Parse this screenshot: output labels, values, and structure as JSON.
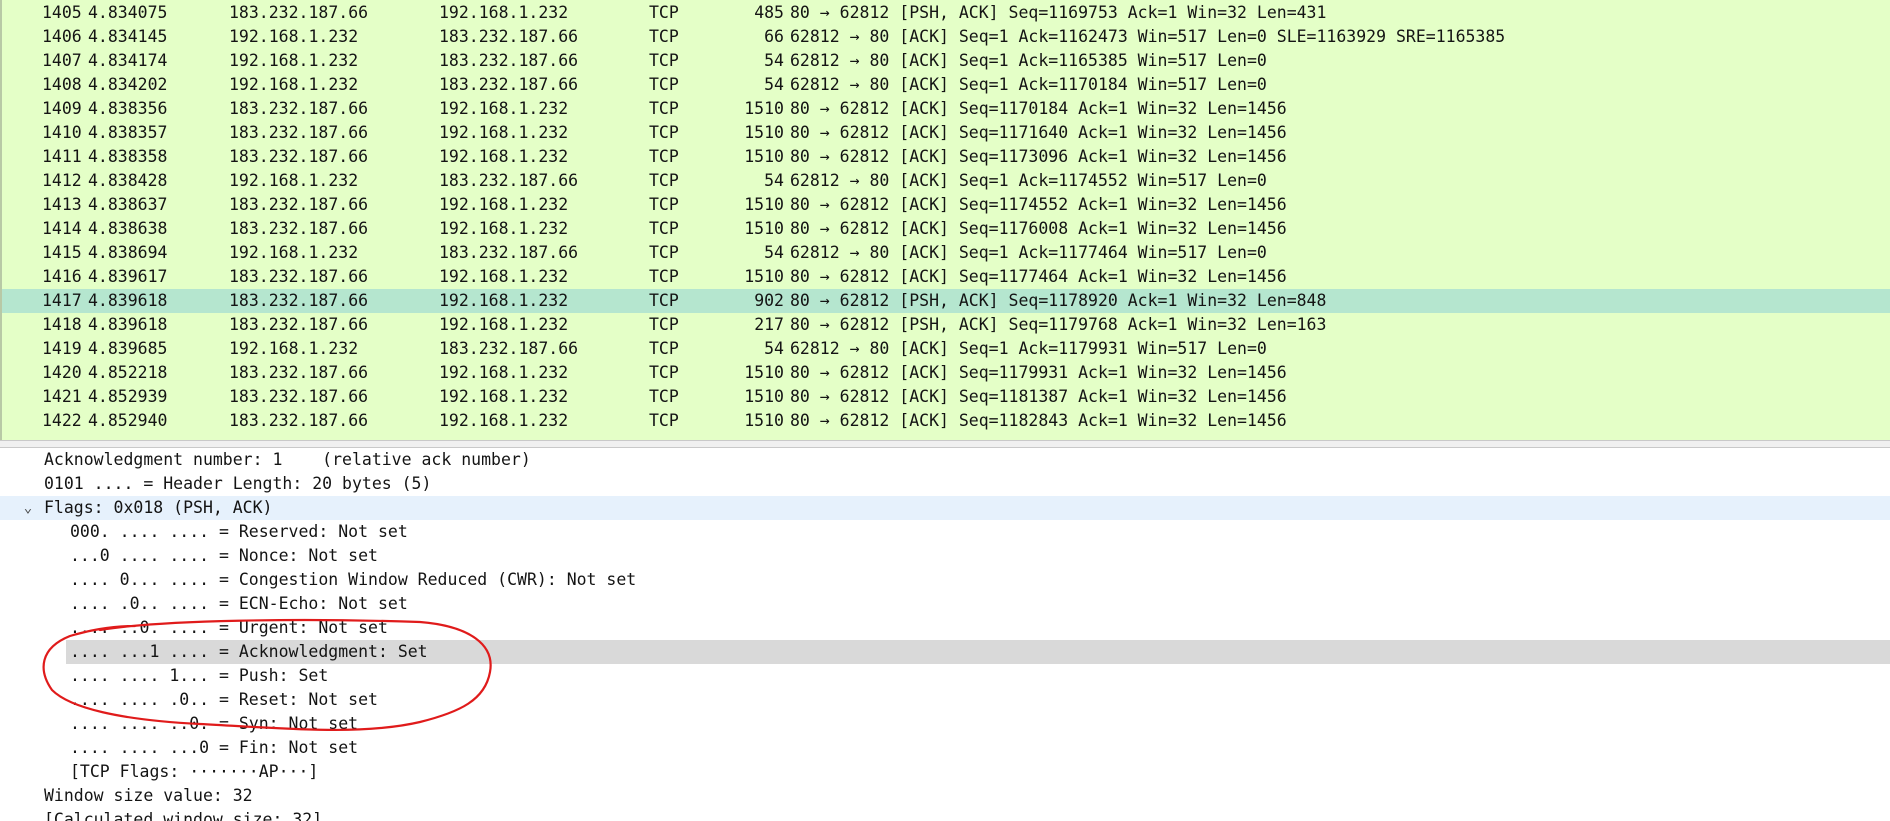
{
  "packet_list": {
    "rows": [
      {
        "no": "1405",
        "time": "4.834075",
        "src": "183.232.187.66",
        "dst": "192.168.1.232",
        "proto": "TCP",
        "len": "485",
        "info": "80 → 62812 [PSH, ACK] Seq=1169753 Ack=1 Win=32 Len=431",
        "selected": false
      },
      {
        "no": "1406",
        "time": "4.834145",
        "src": "192.168.1.232",
        "dst": "183.232.187.66",
        "proto": "TCP",
        "len": "66",
        "info": "62812 → 80 [ACK] Seq=1 Ack=1162473 Win=517 Len=0 SLE=1163929 SRE=1165385",
        "selected": false
      },
      {
        "no": "1407",
        "time": "4.834174",
        "src": "192.168.1.232",
        "dst": "183.232.187.66",
        "proto": "TCP",
        "len": "54",
        "info": "62812 → 80 [ACK] Seq=1 Ack=1165385 Win=517 Len=0",
        "selected": false
      },
      {
        "no": "1408",
        "time": "4.834202",
        "src": "192.168.1.232",
        "dst": "183.232.187.66",
        "proto": "TCP",
        "len": "54",
        "info": "62812 → 80 [ACK] Seq=1 Ack=1170184 Win=517 Len=0",
        "selected": false
      },
      {
        "no": "1409",
        "time": "4.838356",
        "src": "183.232.187.66",
        "dst": "192.168.1.232",
        "proto": "TCP",
        "len": "1510",
        "info": "80 → 62812 [ACK] Seq=1170184 Ack=1 Win=32 Len=1456",
        "selected": false
      },
      {
        "no": "1410",
        "time": "4.838357",
        "src": "183.232.187.66",
        "dst": "192.168.1.232",
        "proto": "TCP",
        "len": "1510",
        "info": "80 → 62812 [ACK] Seq=1171640 Ack=1 Win=32 Len=1456",
        "selected": false
      },
      {
        "no": "1411",
        "time": "4.838358",
        "src": "183.232.187.66",
        "dst": "192.168.1.232",
        "proto": "TCP",
        "len": "1510",
        "info": "80 → 62812 [ACK] Seq=1173096 Ack=1 Win=32 Len=1456",
        "selected": false
      },
      {
        "no": "1412",
        "time": "4.838428",
        "src": "192.168.1.232",
        "dst": "183.232.187.66",
        "proto": "TCP",
        "len": "54",
        "info": "62812 → 80 [ACK] Seq=1 Ack=1174552 Win=517 Len=0",
        "selected": false
      },
      {
        "no": "1413",
        "time": "4.838637",
        "src": "183.232.187.66",
        "dst": "192.168.1.232",
        "proto": "TCP",
        "len": "1510",
        "info": "80 → 62812 [ACK] Seq=1174552 Ack=1 Win=32 Len=1456",
        "selected": false
      },
      {
        "no": "1414",
        "time": "4.838638",
        "src": "183.232.187.66",
        "dst": "192.168.1.232",
        "proto": "TCP",
        "len": "1510",
        "info": "80 → 62812 [ACK] Seq=1176008 Ack=1 Win=32 Len=1456",
        "selected": false
      },
      {
        "no": "1415",
        "time": "4.838694",
        "src": "192.168.1.232",
        "dst": "183.232.187.66",
        "proto": "TCP",
        "len": "54",
        "info": "62812 → 80 [ACK] Seq=1 Ack=1177464 Win=517 Len=0",
        "selected": false
      },
      {
        "no": "1416",
        "time": "4.839617",
        "src": "183.232.187.66",
        "dst": "192.168.1.232",
        "proto": "TCP",
        "len": "1510",
        "info": "80 → 62812 [ACK] Seq=1177464 Ack=1 Win=32 Len=1456",
        "selected": false
      },
      {
        "no": "1417",
        "time": "4.839618",
        "src": "183.232.187.66",
        "dst": "192.168.1.232",
        "proto": "TCP",
        "len": "902",
        "info": "80 → 62812 [PSH, ACK] Seq=1178920 Ack=1 Win=32 Len=848",
        "selected": true
      },
      {
        "no": "1418",
        "time": "4.839618",
        "src": "183.232.187.66",
        "dst": "192.168.1.232",
        "proto": "TCP",
        "len": "217",
        "info": "80 → 62812 [PSH, ACK] Seq=1179768 Ack=1 Win=32 Len=163",
        "selected": false
      },
      {
        "no": "1419",
        "time": "4.839685",
        "src": "192.168.1.232",
        "dst": "183.232.187.66",
        "proto": "TCP",
        "len": "54",
        "info": "62812 → 80 [ACK] Seq=1 Ack=1179931 Win=517 Len=0",
        "selected": false
      },
      {
        "no": "1420",
        "time": "4.852218",
        "src": "183.232.187.66",
        "dst": "192.168.1.232",
        "proto": "TCP",
        "len": "1510",
        "info": "80 → 62812 [ACK] Seq=1179931 Ack=1 Win=32 Len=1456",
        "selected": false
      },
      {
        "no": "1421",
        "time": "4.852939",
        "src": "183.232.187.66",
        "dst": "192.168.1.232",
        "proto": "TCP",
        "len": "1510",
        "info": "80 → 62812 [ACK] Seq=1181387 Ack=1 Win=32 Len=1456",
        "selected": false
      },
      {
        "no": "1422",
        "time": "4.852940",
        "src": "183.232.187.66",
        "dst": "192.168.1.232",
        "proto": "TCP",
        "len": "1510",
        "info": "80 → 62812 [ACK] Seq=1182843 Ack=1 Win=32 Len=1456",
        "selected": false
      }
    ]
  },
  "details": {
    "lines": [
      {
        "text": "Acknowledgment number: 1    (relative ack number)",
        "level": 0
      },
      {
        "text": "0101 .... = Header Length: 20 bytes (5)",
        "level": 0
      },
      {
        "text": "Flags: 0x018 (PSH, ACK)",
        "level": 0,
        "expanded": true
      },
      {
        "text": "000. .... .... = Reserved: Not set",
        "level": 1
      },
      {
        "text": "...0 .... .... = Nonce: Not set",
        "level": 1
      },
      {
        "text": ".... 0... .... = Congestion Window Reduced (CWR): Not set",
        "level": 1
      },
      {
        "text": ".... .0.. .... = ECN-Echo: Not set",
        "level": 1
      },
      {
        "text": ".... ..0. .... = Urgent: Not set",
        "level": 1
      },
      {
        "text": ".... ...1 .... = Acknowledgment: Set",
        "level": 1,
        "selected": true
      },
      {
        "text": ".... .... 1... = Push: Set",
        "level": 1
      },
      {
        "text": ".... .... .0.. = Reset: Not set",
        "level": 1
      },
      {
        "text": ".... .... ..0. = Syn: Not set",
        "level": 1
      },
      {
        "text": ".... .... ...0 = Fin: Not set",
        "level": 1
      },
      {
        "text": "[TCP Flags: ·······AP···]",
        "level": 1
      },
      {
        "text": "Window size value: 32",
        "level": 0
      },
      {
        "text": "[Calculated window size: 32]",
        "level": 0
      }
    ],
    "expander_glyph": "⌄"
  },
  "annotation": {
    "color": "#e01b1b",
    "shape": "hand-drawn-circle"
  },
  "colors": {
    "packet_bg": "#e4ffc7",
    "packet_selected_bg": "#b5e6cf",
    "flags_row_bg": "#e6f1fc",
    "detail_selected_bg": "#d9d9d9"
  }
}
